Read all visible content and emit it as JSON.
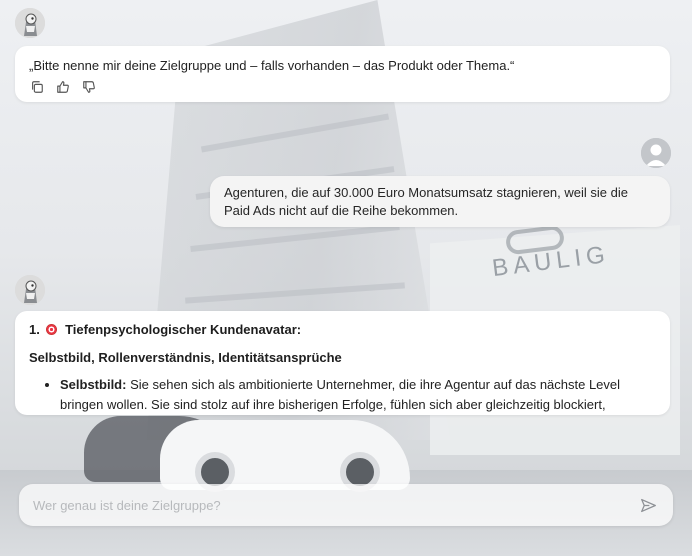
{
  "messages": [
    {
      "role": "assistant",
      "text": "„Bitte nenne mir deine Zielgruppe und – falls vorhanden – das Produkt oder Thema.“",
      "actions": [
        "copy-icon",
        "thumbs-up-icon",
        "thumbs-down-icon"
      ]
    },
    {
      "role": "user",
      "text": "Agenturen, die auf 30.000 Euro Monatsumsatz stagnieren, weil sie die Paid Ads nicht auf die Reihe bekommen."
    },
    {
      "role": "assistant",
      "heading_number": "1.",
      "heading_icon": "target-emoji-icon",
      "heading": "Tiefenpsychologischer Kundenavatar:",
      "subheading": "Selbstbild, Rollenverständnis, Identitätsansprüche",
      "bullets": [
        {
          "label": "Selbstbild:",
          "text": "Sie sehen sich als ambitionierte Unternehmer, die ihre Agentur auf das nächste Level bringen wollen. Sie sind stolz auf ihre bisherigen Erfolge, fühlen sich aber gleichzeitig blockiert,"
        }
      ]
    }
  ],
  "composer": {
    "placeholder": "Wer genau ist deine Zielgruppe?",
    "send_icon": "send-icon"
  },
  "background": {
    "logo_text": "BAULIG"
  },
  "colors": {
    "bubble_assistant": "#ffffff",
    "bubble_user": "#f4f4f4",
    "placeholder": "#b7b9bc"
  }
}
